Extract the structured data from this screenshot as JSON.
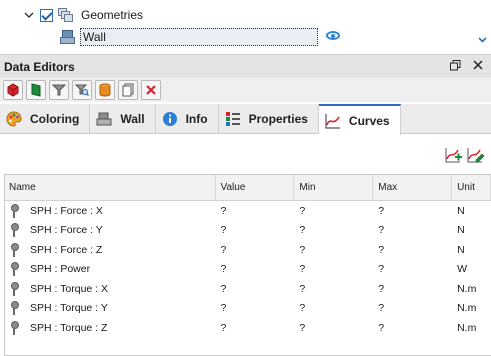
{
  "tree": {
    "geometries_label": "Geometries",
    "wall_label": "Wall",
    "geometries_checked": true
  },
  "panel": {
    "title": "Data Editors"
  },
  "toolbar": {
    "buttons": [
      {
        "icon": "red-cube-icon",
        "color": "#d9232d"
      },
      {
        "icon": "green-flag-icon",
        "color": "#1e8a3a"
      },
      {
        "icon": "filter-icon",
        "color": "#7a7a7a"
      },
      {
        "icon": "search-filter-icon",
        "color": "#4a7fbf"
      },
      {
        "icon": "orange-cylinder-icon",
        "color": "#e88a1e"
      },
      {
        "icon": "copy-icon",
        "color": "#606060"
      },
      {
        "icon": "delete-icon",
        "color": "#d9232d"
      }
    ]
  },
  "tabs": [
    {
      "label": "Coloring",
      "icon": "palette-icon",
      "active": false
    },
    {
      "label": "Wall",
      "icon": "wall-icon",
      "active": false
    },
    {
      "label": "Info",
      "icon": "info-icon",
      "active": false
    },
    {
      "label": "Properties",
      "icon": "properties-icon",
      "active": false
    },
    {
      "label": "Curves",
      "icon": "curves-icon",
      "active": true
    }
  ],
  "table": {
    "columns": [
      "Name",
      "Value",
      "Min",
      "Max",
      "Unit"
    ],
    "rows": [
      {
        "name": "SPH : Force : X",
        "value": "?",
        "min": "?",
        "max": "?",
        "unit": "N"
      },
      {
        "name": "SPH : Force : Y",
        "value": "?",
        "min": "?",
        "max": "?",
        "unit": "N"
      },
      {
        "name": "SPH : Force : Z",
        "value": "?",
        "min": "?",
        "max": "?",
        "unit": "N"
      },
      {
        "name": "SPH : Power",
        "value": "?",
        "min": "?",
        "max": "?",
        "unit": "W"
      },
      {
        "name": "SPH : Torque : X",
        "value": "?",
        "min": "?",
        "max": "?",
        "unit": "N.m"
      },
      {
        "name": "SPH : Torque : Y",
        "value": "?",
        "min": "?",
        "max": "?",
        "unit": "N.m"
      },
      {
        "name": "SPH : Torque : Z",
        "value": "?",
        "min": "?",
        "max": "?",
        "unit": "N.m"
      }
    ]
  },
  "colors": {
    "accent": "#2a6ebf",
    "active_tab_border": "#2a6ebf"
  }
}
